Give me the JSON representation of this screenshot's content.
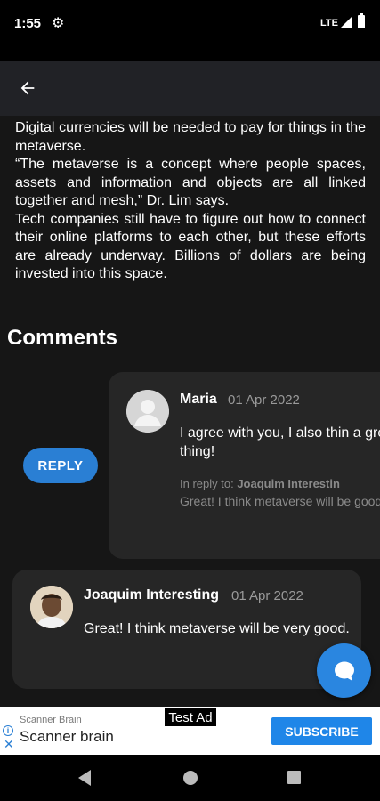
{
  "status_bar": {
    "time": "1:55",
    "network": "LTE",
    "icons": [
      "gear-icon",
      "signal-icon",
      "battery-icon"
    ]
  },
  "app_bar": {
    "back_icon": "arrow-left-icon"
  },
  "article": {
    "paragraphs": [
      "Digital currencies will be needed to pay for things in the metaverse.",
      "“The metaverse is a concept where people spaces, assets and information and objects are all linked together and mesh,” Dr. Lim says.",
      "Tech companies still have to figure out how to connect their online platforms to each other, but these efforts are already underway. Billions of dollars are being invested into this space."
    ]
  },
  "comments": {
    "heading": "Comments",
    "reply_label": "REPLY",
    "reply": {
      "author": "Maria",
      "date": "01 Apr 2022",
      "text": "I agree with you, I also thin a great thing!",
      "in_reply_to_label": "In reply to:",
      "in_reply_to_author": "Joaquim Interestin",
      "quoted_text": "Great! I think metaverse will be good."
    },
    "comment": {
      "author": "Joaquim Interesting",
      "date": "01 Apr 2022",
      "text": "Great! I think metaverse will be very good."
    }
  },
  "fab": {
    "icon": "chat-bubble-icon",
    "color": "#2a86e0"
  },
  "ad": {
    "badge": "Test Ad",
    "advertiser": "Scanner Brain",
    "headline": "Scanner brain",
    "cta": "SUBSCRIBE"
  },
  "colors": {
    "accent": "#2a7fd4",
    "card": "#262626",
    "background": "#161616",
    "app_bar": "#212226"
  }
}
